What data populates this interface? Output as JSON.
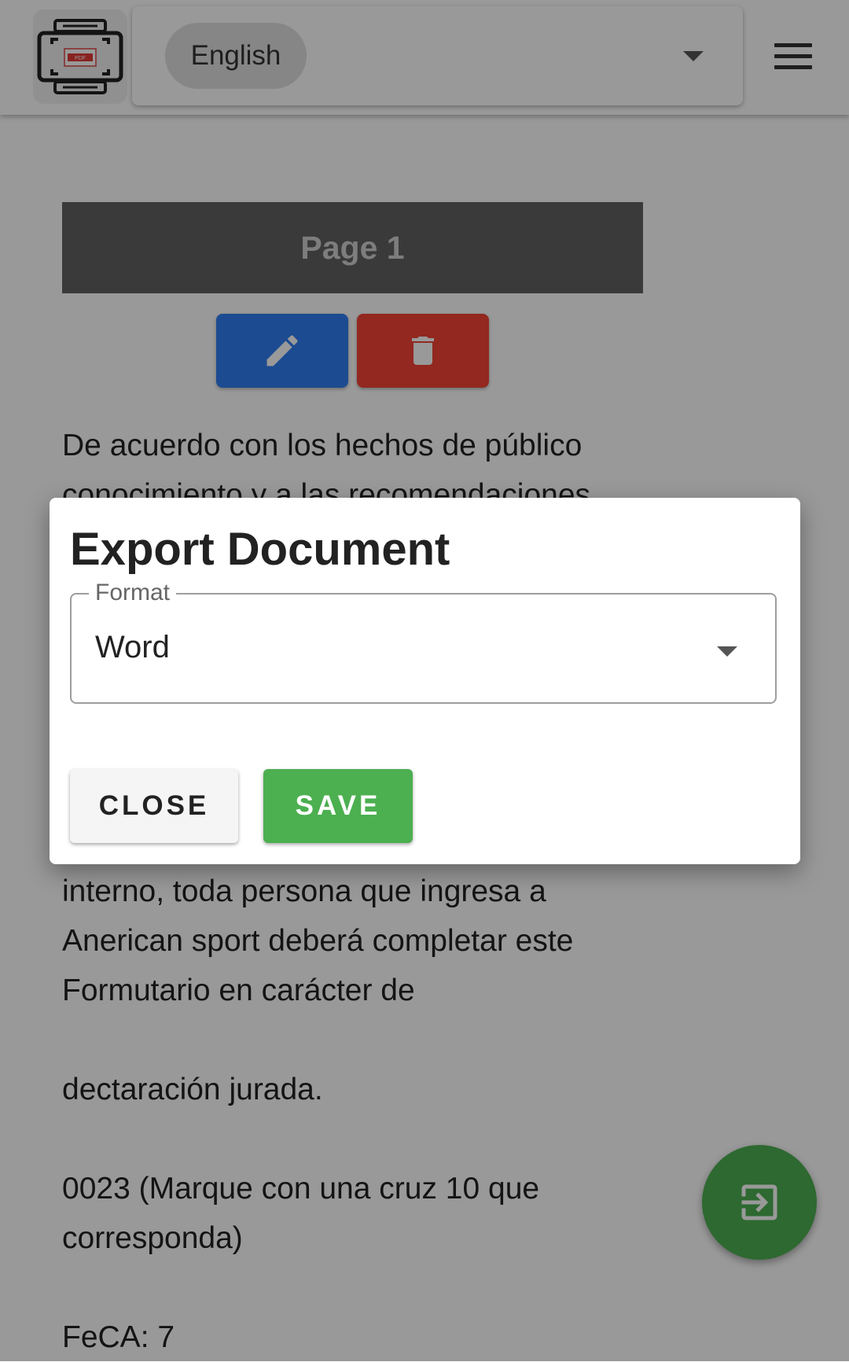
{
  "header": {
    "logo_icon": "pdf-scan-logo-icon",
    "language": "English",
    "menu_icon": "hamburger-menu-icon"
  },
  "page": {
    "title": "Page 1",
    "edit_icon": "pencil-icon",
    "delete_icon": "trash-icon",
    "edit_color": "#2f7ef2",
    "delete_color": "#f44336"
  },
  "content": {
    "lines": [
      "De acuerdo con los hechos de público",
      "conocimiento y a las recomendaciones",
      "interno, toda persona que ingresa a",
      "Anerican sport deberá completar este",
      "Formutario en carácter de",
      "dectaración jurada.",
      "0023 (Marque con una cruz 10 que",
      "corresponda)",
      "FeCA: 7"
    ]
  },
  "fab": {
    "icon": "exit-to-app-icon",
    "color": "#4caf50"
  },
  "dialog": {
    "title": "Export Document",
    "format_label": "Format",
    "format_value": "Word",
    "close_label": "CLOSE",
    "save_label": "SAVE",
    "save_color": "#4caf50"
  }
}
